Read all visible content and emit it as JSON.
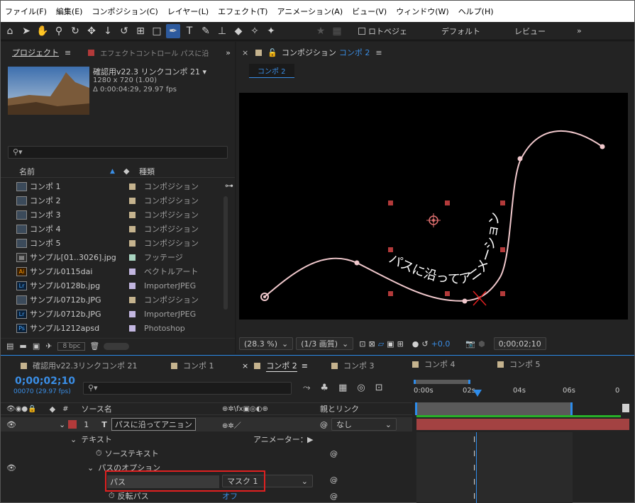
{
  "menu": [
    "ファイル(F)",
    "編集(E)",
    "コンポジション(C)",
    "レイヤー(L)",
    "エフェクト(T)",
    "アニメーション(A)",
    "ビュー(V)",
    "ウィンドウ(W)",
    "ヘルプ(H)"
  ],
  "toolbar": {
    "roto": "ロトベジェ",
    "default": "デフォルト",
    "review": "レビュー"
  },
  "project": {
    "tab_label": "プロジェクト",
    "effect_tab": "エフェクトコントロール パスに沿",
    "comp_name": "確認用v22.3 リンクコンポ 21 ▾",
    "comp_dims": "1280 x 720 (1.00)",
    "comp_time": "Δ 0:00:04:29, 29.97 fps",
    "col_name": "名前",
    "col_type": "種類",
    "bpc": "8 bpc",
    "items": [
      {
        "name": "コンポ 1",
        "type": "コンポジション",
        "icon": "comp",
        "color": "#c5b38e"
      },
      {
        "name": "コンポ 2",
        "type": "コンポジション",
        "icon": "comp",
        "color": "#c5b38e"
      },
      {
        "name": "コンポ 3",
        "type": "コンポジション",
        "icon": "comp",
        "color": "#c5b38e"
      },
      {
        "name": "コンポ 4",
        "type": "コンポジション",
        "icon": "comp",
        "color": "#c5b38e"
      },
      {
        "name": "コンポ 5",
        "type": "コンポジション",
        "icon": "comp",
        "color": "#c5b38e"
      },
      {
        "name": "サンプル[01..3026].jpg",
        "type": "フッテージ",
        "icon": "footage",
        "color": "#a8d4c0"
      },
      {
        "name": "サンプル0115dai",
        "type": "ベクトルアート",
        "icon": "ai",
        "color": "#c2b6e0"
      },
      {
        "name": "サンプル0128b.jpg",
        "type": "ImporterJPEG",
        "icon": "lr",
        "color": "#c2b6e0"
      },
      {
        "name": "サンプル0712b.JPG",
        "type": "コンポジション",
        "icon": "comp",
        "color": "#c5b38e"
      },
      {
        "name": "サンプル0712b.JPG",
        "type": "ImporterJPEG",
        "icon": "lr",
        "color": "#c2b6e0"
      },
      {
        "name": "サンプル1212apsd",
        "type": "Photoshop",
        "icon": "ps",
        "color": "#c2b6e0"
      }
    ]
  },
  "composition": {
    "tab_prefix": "コンポジション",
    "tab_name": "コンポ 2",
    "subtab": "コンポ 2",
    "path_text": "パスに沿ってアニメーション",
    "zoom": "(28.3 %)",
    "resolution": "(1/3 画質)",
    "exposure": "+0.0",
    "timecode": "0;00;02;10"
  },
  "timeline": {
    "tabs": [
      "確認用v22.3リンクコンポ 21",
      "コンポ 1",
      "コンポ 2",
      "コンポ 3",
      "コンポ 4",
      "コンポ 5"
    ],
    "timecode": "0;00;02;10",
    "frame_info": "00070 (29.97 fps)",
    "col_source": "ソース名",
    "col_parent": "親とリンク",
    "ruler": [
      "0:00s",
      "02s",
      "04s",
      "06s",
      "0"
    ],
    "layer": {
      "num": "1",
      "name": "パスに沿ってアニョン",
      "parent": "なし"
    },
    "props": {
      "text": "テキスト",
      "animator": "アニメーター：",
      "source_text": "ソーステキスト",
      "path_options": "パスのオプション",
      "path_label": "パス",
      "mask_value": "マスク 1",
      "reverse": "反転パス",
      "reverse_value": "オフ"
    }
  },
  "colors": {
    "accent": "#2d8ceb",
    "layer_red": "#b33a3a",
    "highlight": "#e02020",
    "path": "#f0c8cc"
  }
}
